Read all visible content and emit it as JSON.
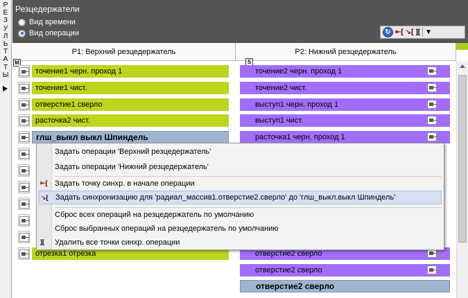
{
  "sidebar_strip": {
    "letters": [
      "Р",
      "Е",
      "З",
      "У",
      "Л",
      "Ь",
      "Т",
      "А",
      "Т",
      "Ы"
    ]
  },
  "panel": {
    "title": "Резцедержатели",
    "radio_time": "Вид времени",
    "radio_operation": "Вид операции",
    "selected_view": "Вид операции"
  },
  "toolbar": {
    "icons": [
      "refresh-icon",
      "sync-start-icon",
      "sync-op-icon",
      "sync-all-icon",
      "dropdown-icon"
    ]
  },
  "columns": {
    "p1": "P1: Верхний резцедержатель",
    "p2": "P2: Нижний резцедержатель",
    "p1_marker": "M",
    "p2_marker": "S"
  },
  "left_ops": [
    "точение1 черн. проход 1",
    "точение1 чист.",
    "отверстие1 сверло",
    "расточка2 чист.",
    "глш_выкл выкл Шпиндель",
    "отрезка1 отрезка"
  ],
  "right_ops": [
    "точение2 черн. проход 1",
    "точение2 чист.",
    "выступ1 черн. проход 1",
    "выступ1 чист.",
    "расточка1 черн. проход 1",
    "отверстие2 сверло",
    "отверстие2 сверло",
    "отверстие2 сверло"
  ],
  "context_menu": [
    "Задать операции 'Верхний резцедержатель'",
    "Задать операции 'Нижний резцедержатель'",
    "Задать точку синхр. в начале операции",
    "Задать синхронизацию для 'радиал_массив1.отверстие2.сверло' до 'глш_выкл.выкл Шпиндель'",
    "Сброс всех операций на резцедержатель по умолчанию",
    "Сброс выбранных операций на резцедержатель по умолчанию",
    "Удалить все точки синхр. операции"
  ],
  "colors": {
    "upper_op": "#bdd51c",
    "lower_op": "#a16dfa",
    "selected_op": "#9fb4ce",
    "header_bg": "#555555"
  }
}
